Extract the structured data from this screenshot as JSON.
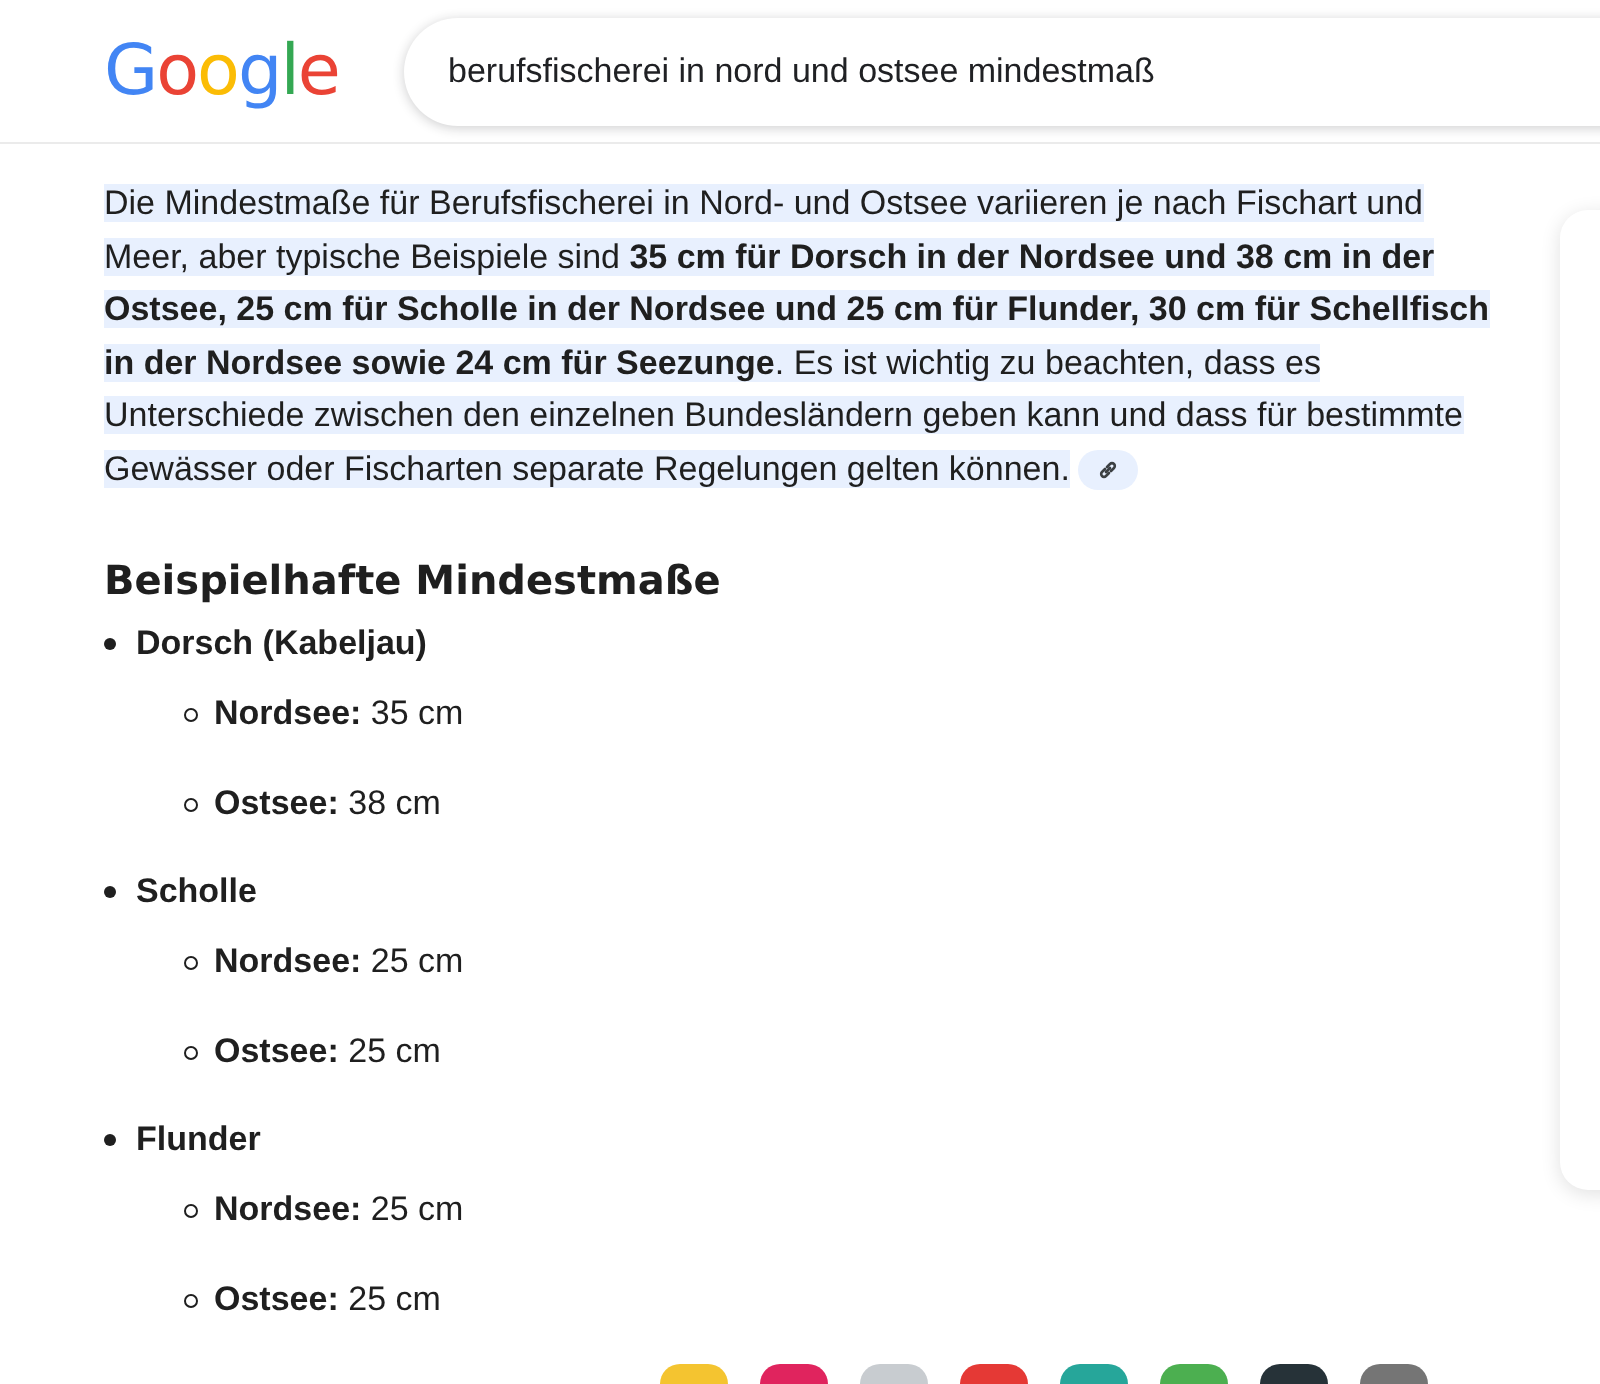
{
  "logo": "Google",
  "search": {
    "value": "berufsfischerei in nord und ostsee mindestmaß"
  },
  "overview": {
    "text": "Die Mindestmaße für Berufsfischerei in Nord- und Ostsee variieren je nach Fischart und Meer, aber typische Beispiele sind **35 cm für Dorsch in der Nordsee und 38 cm in der Ostsee, 25 cm für Scholle in der Nordsee und 25 cm für Flunder, 30 cm für Schellfisch in der Nordsee sowie 24 cm für Seezunge**. Es ist wichtig zu beachten, dass es Unterschiede zwischen den einzelnen Bundesländern geben kann und dass für bestimmte Gewässer oder Fischarten separate Regelungen gelten können."
  },
  "heading": "Beispielhafte Mindestmaße",
  "items": [
    {
      "name": "Dorsch (Kabeljau)",
      "children": [
        {
          "label": "Nordsee:",
          "value": "35 cm"
        },
        {
          "label": "Ostsee:",
          "value": "38 cm"
        }
      ]
    },
    {
      "name": "Scholle",
      "children": [
        {
          "label": "Nordsee:",
          "value": "25 cm"
        },
        {
          "label": "Ostsee:",
          "value": "25 cm"
        }
      ]
    },
    {
      "name": "Flunder",
      "children": [
        {
          "label": "Nordsee:",
          "value": "25 cm"
        },
        {
          "label": "Ostsee:",
          "value": "25 cm"
        }
      ]
    }
  ]
}
